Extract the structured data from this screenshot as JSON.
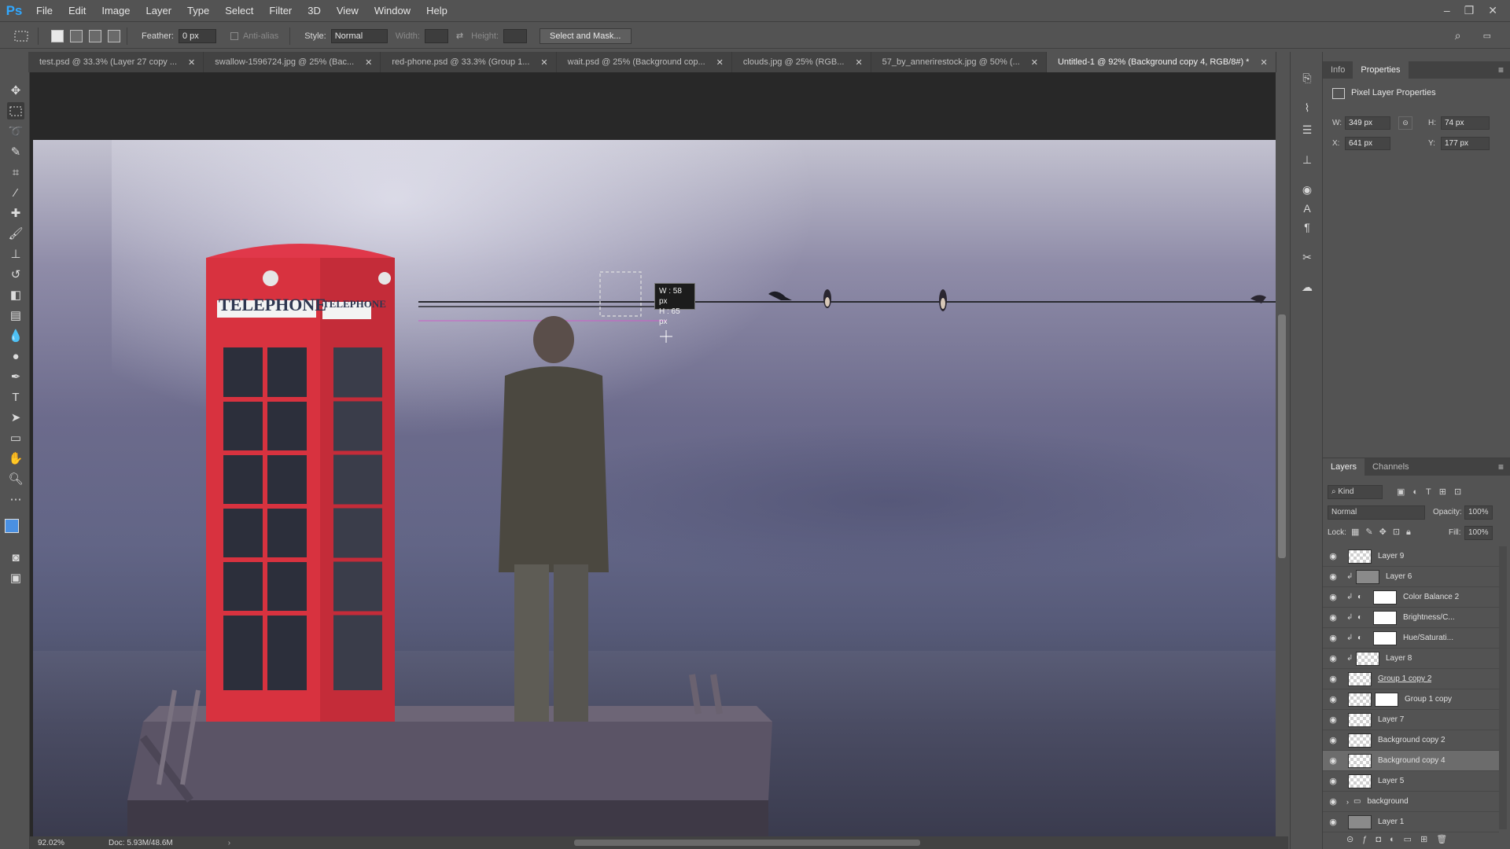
{
  "menubar": {
    "logo": "Ps",
    "items": [
      "File",
      "Edit",
      "Image",
      "Layer",
      "Type",
      "Select",
      "Filter",
      "3D",
      "View",
      "Window",
      "Help"
    ],
    "window_controls": [
      "–",
      "❐",
      "✕"
    ]
  },
  "options": {
    "feather_label": "Feather:",
    "feather_value": "0 px",
    "antialias_label": "Anti-alias",
    "style_label": "Style:",
    "style_value": "Normal",
    "width_label": "Width:",
    "height_label": "Height:",
    "select_mask_button": "Select and Mask..."
  },
  "tabs": [
    {
      "label": "test.psd @ 33.3% (Layer 27 copy ..."
    },
    {
      "label": "swallow-1596724.jpg @ 25% (Bac..."
    },
    {
      "label": "red-phone.psd @ 33.3% (Group 1..."
    },
    {
      "label": "wait.psd @ 25% (Background cop..."
    },
    {
      "label": "clouds.jpg @ 25% (RGB..."
    },
    {
      "label": "57_by_annerirestock.jpg @ 50% (..."
    },
    {
      "label": "Untitled-1 @ 92% (Background copy 4, RGB/8#) *"
    }
  ],
  "canvas": {
    "booth_sign_left": "TELEPHONE",
    "booth_sign_right": "TELEPHONE",
    "tooltip_w": "W : 58 px",
    "tooltip_h": "H : 65 px"
  },
  "status": {
    "zoom": "92.02%",
    "doc": "Doc: 5.93M/48.6M"
  },
  "properties": {
    "tabs": [
      "Info",
      "Properties"
    ],
    "title": "Pixel Layer Properties",
    "w_label": "W:",
    "w_value": "349 px",
    "h_label": "H:",
    "h_value": "74 px",
    "x_label": "X:",
    "x_value": "641 px",
    "y_label": "Y:",
    "y_value": "177 px"
  },
  "layers_panel": {
    "tabs": [
      "Layers",
      "Channels"
    ],
    "filter_kind": "Kind",
    "blend_mode": "Normal",
    "opacity_label": "Opacity:",
    "opacity_value": "100%",
    "lock_label": "Lock:",
    "fill_label": "Fill:",
    "fill_value": "100%",
    "layers": [
      {
        "name": "Layer 9",
        "selected": false
      },
      {
        "name": "Layer 6",
        "selected": false
      },
      {
        "name": "Color Balance 2",
        "selected": false
      },
      {
        "name": "Brightness/C...",
        "selected": false
      },
      {
        "name": "Hue/Saturati...",
        "selected": false
      },
      {
        "name": "Layer 8",
        "selected": false
      },
      {
        "name": "Group 1 copy 2",
        "selected": false
      },
      {
        "name": "Group 1 copy",
        "selected": false
      },
      {
        "name": "Layer 7",
        "selected": false
      },
      {
        "name": "Background copy 2",
        "selected": false
      },
      {
        "name": "Background copy 4",
        "selected": true
      },
      {
        "name": "Layer 5",
        "selected": false
      },
      {
        "name": "background",
        "selected": false
      },
      {
        "name": "Layer 1",
        "selected": false
      }
    ]
  },
  "colors": {
    "accent": "#31a8ff",
    "booth_red": "#e0384a",
    "panel_bg": "#535353"
  }
}
